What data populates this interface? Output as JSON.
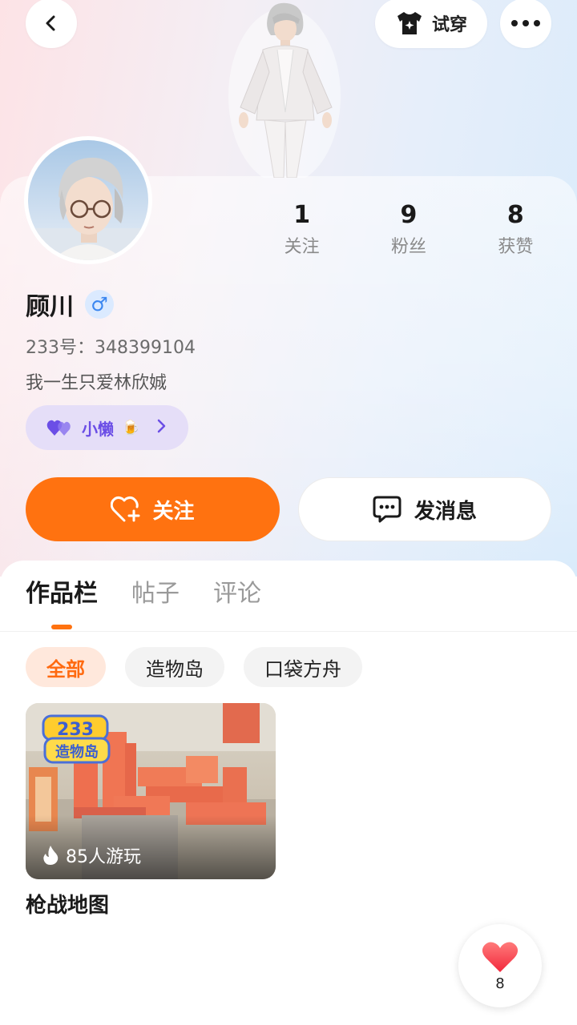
{
  "header": {
    "tryon_label": "试穿"
  },
  "profile": {
    "name": "顾川",
    "gender_symbol": "♂",
    "uid": "233号：348399104",
    "bio": "我一生只爱林欣娍"
  },
  "stats": [
    {
      "value": "1",
      "label": "关注"
    },
    {
      "value": "9",
      "label": "粉丝"
    },
    {
      "value": "8",
      "label": "获赞"
    }
  ],
  "badge": {
    "label": "小懒",
    "emoji": "🍺"
  },
  "actions": {
    "follow_label": "关注",
    "message_label": "发消息"
  },
  "tabs": [
    {
      "label": "作品栏",
      "active": true
    },
    {
      "label": "帖子",
      "active": false
    },
    {
      "label": "评论",
      "active": false
    }
  ],
  "filters": [
    {
      "label": "全部",
      "active": true
    },
    {
      "label": "造物岛",
      "active": false
    },
    {
      "label": "口袋方舟",
      "active": false
    }
  ],
  "works": [
    {
      "title": "枪战地图",
      "plays": "85人游玩",
      "logo_text": "233",
      "logo_sub": "造物岛"
    }
  ],
  "like_fab": {
    "count": "8"
  },
  "colors": {
    "accent": "#ff7210",
    "badge_purple": "#6b4ee6",
    "gender_blue": "#3a86f0"
  }
}
